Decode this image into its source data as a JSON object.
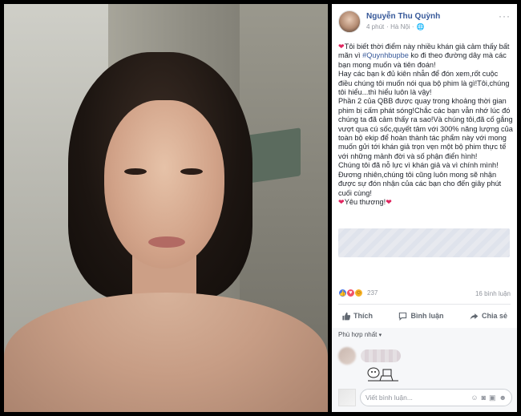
{
  "post": {
    "author": "Nguyễn Thu Quỳnh",
    "time": "4 phút",
    "location": "· Hà Nội ·",
    "paragraphs": [
      "Tôi biết thời điểm này nhiều khán giả cảm thấy bất mãn vì ",
      "ko đi theo đường dây mà các bạn mong muốn và tiên đoán!",
      "Hay các bạn k đủ kiên nhẫn để đón xem,rốt cuộc điều chúng tôi muốn nói qua bộ phim là gì!Tôi,chúng tôi hiểu...thì hiểu luôn là vậy!",
      "Phần 2 của QBB được quay trong khoảng thời gian phim bị cấm phát sóng!Chắc các bạn vẫn nhớ lúc đó chúng ta đã cảm thấy ra sao!Và chúng tôi,đã cố gắng vượt qua cú sốc,quyết tâm với 300% năng lượng của toàn bộ ekip để hoàn thành tác phẩm này với mong muốn gửi tới khán giả trọn vẹn một bộ phim thực tế với những mảnh đời và số phận điển hình!",
      "Chúng tôi đã nỗ lực vì khán giả và vì chính mình!",
      "Đương nhiên,chúng tôi cũng luôn mong sẽ nhận được sự đón nhận của các bạn cho đến giây phút cuối cùng!",
      "Yêu thương!"
    ],
    "hashtag": "#Quynhbupbe"
  },
  "reactions": {
    "count": "237",
    "comments": "16 bình luận",
    "icons": [
      "like-icon",
      "love-icon",
      "haha-icon"
    ]
  },
  "actions": {
    "like": "Thích",
    "comment": "Bình luận",
    "share": "Chia sẻ"
  },
  "comments": {
    "sort_label": "Phù hợp nhất",
    "composer_placeholder": "Viết bình luận..."
  },
  "colors": {
    "link": "#365899",
    "heart": "#e0245e",
    "like": "#4a76e8",
    "love": "#f25268",
    "haha": "#f7b125"
  }
}
